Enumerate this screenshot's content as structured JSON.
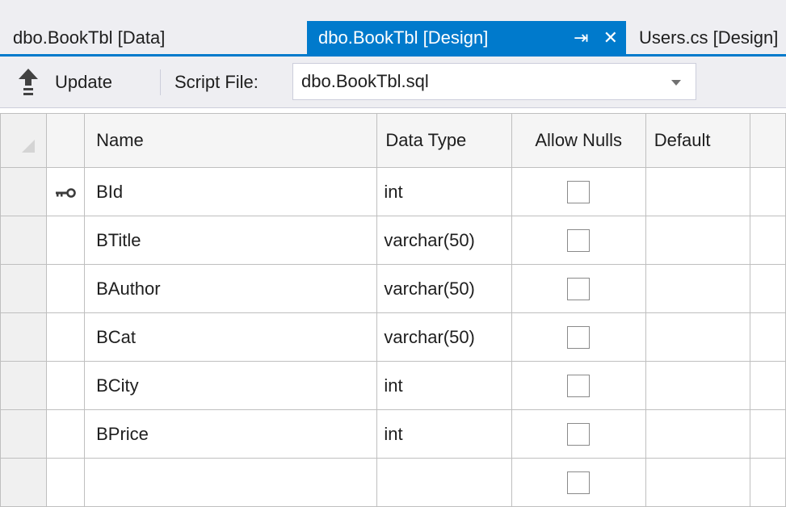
{
  "tabs": {
    "data_tab": "dbo.BookTbl [Data]",
    "design_tab": "dbo.BookTbl [Design]",
    "users_tab": "Users.cs [Design]"
  },
  "toolbar": {
    "update_label": "Update",
    "script_file_label": "Script File:",
    "script_file_value": "dbo.BookTbl.sql"
  },
  "grid": {
    "headers": {
      "name": "Name",
      "data_type": "Data Type",
      "allow_nulls": "Allow Nulls",
      "default": "Default"
    },
    "rows": [
      {
        "name": "BId",
        "type": "int",
        "primary_key": true,
        "allow_nulls": false,
        "default": ""
      },
      {
        "name": "BTitle",
        "type": "varchar(50)",
        "primary_key": false,
        "allow_nulls": false,
        "default": ""
      },
      {
        "name": "BAuthor",
        "type": "varchar(50)",
        "primary_key": false,
        "allow_nulls": false,
        "default": ""
      },
      {
        "name": "BCat",
        "type": "varchar(50)",
        "primary_key": false,
        "allow_nulls": false,
        "default": ""
      },
      {
        "name": "BCity",
        "type": "int",
        "primary_key": false,
        "allow_nulls": false,
        "default": ""
      },
      {
        "name": "BPrice",
        "type": "int",
        "primary_key": false,
        "allow_nulls": false,
        "default": ""
      },
      {
        "name": "",
        "type": "",
        "primary_key": false,
        "allow_nulls": false,
        "default": ""
      }
    ]
  },
  "colors": {
    "accent": "#007acc",
    "chrome": "#eeeef2",
    "grid_line": "#bfbfbf"
  },
  "icons": {
    "update": "arrow-up-icon",
    "key": "key-icon",
    "pin": "pin-icon",
    "close": "close-icon"
  }
}
